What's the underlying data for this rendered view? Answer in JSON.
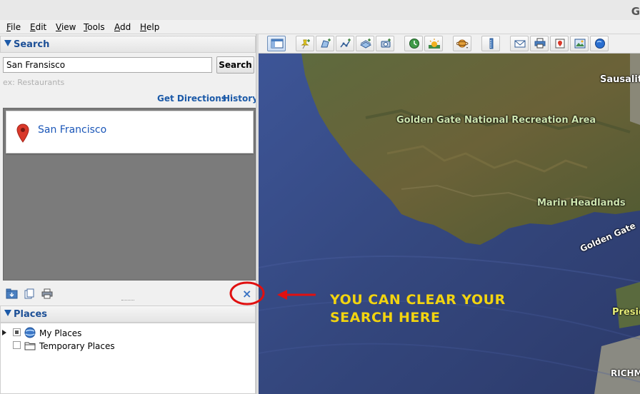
{
  "window": {
    "brand_letter": "G"
  },
  "menu": {
    "items": [
      {
        "label": "File",
        "underline": "F",
        "rest": "ile"
      },
      {
        "label": "Edit",
        "underline": "E",
        "rest": "dit"
      },
      {
        "label": "View",
        "underline": "V",
        "rest": "iew"
      },
      {
        "label": "Tools",
        "underline": "T",
        "rest": "ools"
      },
      {
        "label": "Add",
        "underline": "A",
        "rest": "dd"
      },
      {
        "label": "Help",
        "underline": "H",
        "rest": "elp"
      }
    ]
  },
  "search": {
    "header": "Search",
    "input_value": "San Fransisco",
    "button_label": "Search",
    "hint": "ex: Restaurants",
    "get_directions": "Get Directions",
    "history": "History",
    "result": {
      "label": "San Francisco",
      "icon": "map-pin-icon"
    },
    "clear_glyph": "×"
  },
  "places": {
    "header": "Places",
    "items": [
      {
        "label": "My Places",
        "icon": "globe-icon",
        "checked": true,
        "expandable": true
      },
      {
        "label": "Temporary Places",
        "icon": "folder-icon",
        "checked": false,
        "expandable": false
      }
    ]
  },
  "map": {
    "labels": {
      "sausalito": "Sausalito",
      "ggnra": "Golden Gate National Recreation Area",
      "marin": "Marin Headlands",
      "golden_gate": "Golden Gate",
      "presidio": "Presid",
      "richmond": "RICHM"
    }
  },
  "annotation": {
    "line1": "YOU CAN CLEAR YOUR",
    "line2": "SEARCH HERE",
    "color": "#f2d40f",
    "highlight_color": "#e01010"
  },
  "colors": {
    "link": "#1c5aa8",
    "water": "#3a4c84"
  }
}
